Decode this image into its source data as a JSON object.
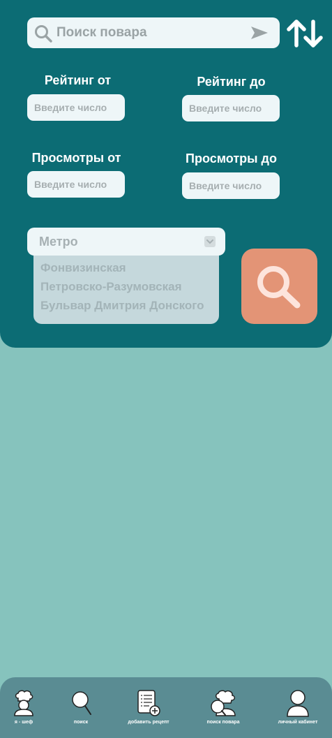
{
  "search": {
    "placeholder": "Поиск повара",
    "value": ""
  },
  "filters": {
    "rating_from": {
      "label": "Рейтинг от",
      "placeholder": "Введите число"
    },
    "rating_to": {
      "label": "Рейтинг до",
      "placeholder": "Введите число"
    },
    "views_from": {
      "label": "Просмотры от",
      "placeholder": "Введите число"
    },
    "views_to": {
      "label": "Просмотры до",
      "placeholder": "Введите число"
    }
  },
  "metro": {
    "placeholder": "Метро",
    "options": [
      "Фонвизинская",
      "Петровско-Разумовская",
      "Бульвар Дмитрия Донского"
    ]
  },
  "icons": {
    "search": "search-icon",
    "send": "send-arrow-icon",
    "sort": "sort-updown-icon",
    "chevron": "chevron-down-icon",
    "big_search": "magnifier-icon"
  },
  "colors": {
    "panel": "#0c6c74",
    "page_bg": "#86c3bd",
    "accent": "#e39476",
    "nav_bg": "#5a8c93"
  },
  "nav": {
    "items": [
      {
        "label": "я - шеф",
        "icon": "chef-icon"
      },
      {
        "label": "поиск",
        "icon": "search-icon"
      },
      {
        "label": "добавить рецепт",
        "icon": "add-recipe-icon"
      },
      {
        "label": "поиск повара",
        "icon": "chef-search-icon"
      },
      {
        "label": "личный кабинет",
        "icon": "user-icon"
      }
    ]
  }
}
